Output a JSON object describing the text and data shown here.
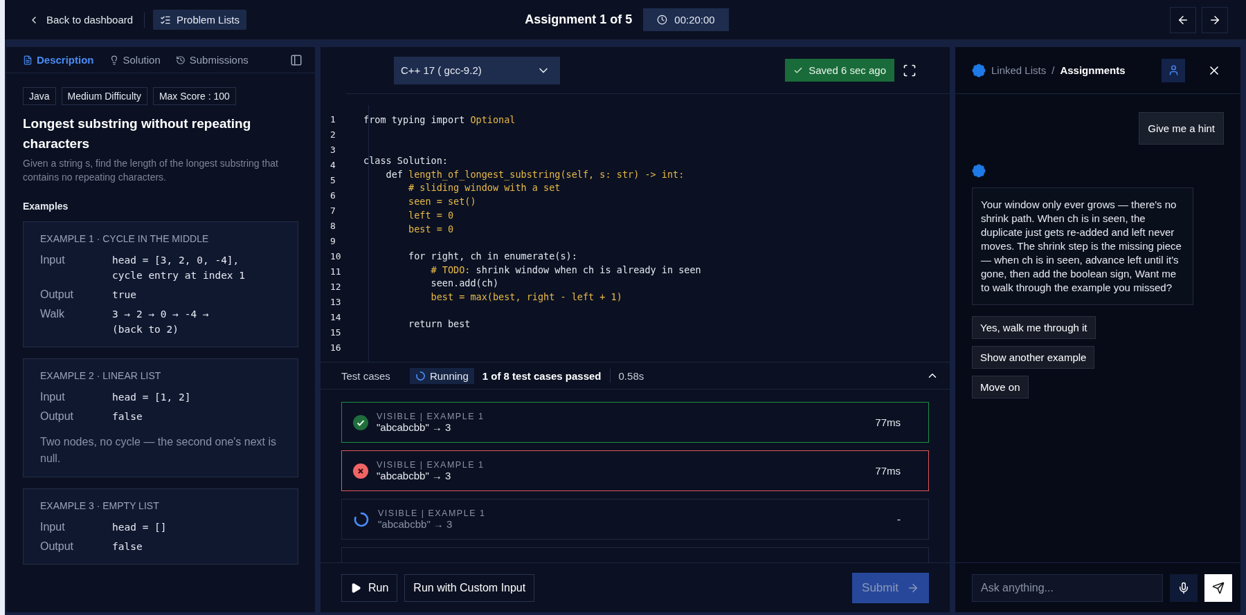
{
  "top_bar": {
    "back_link": "Back to dashboard",
    "problem_lists": "Problem Lists",
    "title": "Assignment 1 of 5",
    "timer": "00:20:00"
  },
  "description_panel": {
    "tabs": [
      {
        "label": "Description",
        "kind": "doc",
        "selected": true
      },
      {
        "label": "Solution",
        "kind": "bulb",
        "selected": false
      },
      {
        "label": "Submissions",
        "kind": "history",
        "selected": false
      }
    ],
    "tags": [
      "Java",
      "Medium Difficulty",
      "Max Score : 100"
    ],
    "title": "Longest substring without repeating characters",
    "description": "Given a string s, find the length of the longest substring that contains no repeating characters.",
    "examples_heading": "Examples",
    "examples": [
      {
        "title": "EXAMPLE 1 · CYCLE IN THE MIDDLE",
        "rows": [
          {
            "label": "Input",
            "lines": [
              "head = [3, 2, 0, -4],",
              "cycle entry at index 1"
            ]
          },
          {
            "label": "Output",
            "lines": [
              "true"
            ]
          },
          {
            "label": "Walk",
            "lines": [
              "3 → 2 → 0 → -4 →",
              "(back to 2)"
            ]
          }
        ]
      },
      {
        "title": "EXAMPLE 2 · LINEAR LIST",
        "rows": [
          {
            "label": "Input",
            "lines": [
              "head = [1, 2]"
            ]
          },
          {
            "label": "Output",
            "lines": [
              "false"
            ]
          }
        ],
        "note": "Two nodes, no cycle — the second one's next is null."
      },
      {
        "title": "EXAMPLE 3 · EMPTY LIST",
        "rows": [
          {
            "label": "Input",
            "lines": [
              "head = []"
            ]
          },
          {
            "label": "Output",
            "lines": [
              "false"
            ]
          }
        ]
      }
    ]
  },
  "editor": {
    "language": "C++ 17 ( gcc-9.2)",
    "saved": "Saved 6 sec ago",
    "line_numbers": [
      "1",
      "2",
      "3",
      "4",
      "5",
      "6",
      "7",
      "8",
      "9",
      "10",
      "11",
      "12",
      "13",
      "14",
      "15",
      "16"
    ],
    "lines": [
      {
        "kind": "code",
        "segments": [
          {
            "text": "from typing import ",
            "kind": "plain"
          },
          {
            "text": "Optional",
            "kind": "accent"
          }
        ]
      },
      {
        "kind": "blank"
      },
      {
        "kind": "blank"
      },
      {
        "segments": [
          {
            "text": "class Solution:",
            "kind": "plain"
          }
        ]
      },
      {
        "segments": [
          {
            "text": "    def ",
            "kind": "plain"
          },
          {
            "text": "length_of_longest_substring(self, s: str) -> int:",
            "kind": "accent"
          }
        ]
      },
      {
        "segments": [
          {
            "text": "        # sliding window with a set",
            "kind": "accent"
          }
        ]
      },
      {
        "segments": [
          {
            "text": "        seen = set()",
            "kind": "accent"
          }
        ]
      },
      {
        "segments": [
          {
            "text": "        left = 0",
            "kind": "accent"
          }
        ]
      },
      {
        "segments": [
          {
            "text": "        best = 0",
            "kind": "accent"
          }
        ]
      },
      {
        "kind": "blank"
      },
      {
        "segments": [
          {
            "text": "        for right, ch in enumerate(s):",
            "kind": "plain"
          }
        ]
      },
      {
        "segments": [
          {
            "text": "            # TODO:",
            "kind": "accent"
          },
          {
            "text": " shrink window when ch is already in seen",
            "kind": "plain"
          }
        ]
      },
      {
        "segments": [
          {
            "text": "            seen.add(ch)",
            "kind": "plain"
          }
        ]
      },
      {
        "segments": [
          {
            "text": "            best = max(best, right - left + 1)",
            "kind": "accent"
          }
        ]
      },
      {
        "kind": "blank"
      },
      {
        "segments": [
          {
            "text": "        return best",
            "kind": "plain"
          }
        ]
      }
    ]
  },
  "test_cases": {
    "heading": "Test cases",
    "status": "Running",
    "summary": "1 of 8 test cases passed",
    "duration": "0.58s",
    "expanded": true,
    "cases": [
      {
        "kind": "passed",
        "label": "VISIBLE | EXAMPLE 1",
        "case": "\"abcabcbb\" → 3",
        "time": "77ms"
      },
      {
        "kind": "failed",
        "label": "VISIBLE | EXAMPLE 1",
        "case": "\"abcabcbb\" → 3",
        "time": "77ms"
      },
      {
        "kind": "running",
        "label": "VISIBLE | EXAMPLE 1",
        "case": "\"abcabcbb\" → 3",
        "time": "-"
      }
    ]
  },
  "actions": {
    "run": "Run",
    "custom": "Run with Custom Input",
    "submit": "Submit",
    "submit_disabled": true
  },
  "assistant": {
    "breadcrumb": "Linked Lists",
    "separator": "/",
    "current": "Assignments",
    "messages": [
      {
        "kind": "user",
        "text": "Give me a hint"
      },
      {
        "kind": "assistant",
        "text": "Your window only ever grows — there's no shrink path. When ch is in seen, the duplicate just gets re-added and left never moves. The shrink step is the missing piece — when ch is in seen, advance left until it's gone, then add the boolean sign, Want me to walk through the example you missed?"
      }
    ],
    "suggestions": [
      "Yes, walk me through it",
      "Show another example",
      "Move on"
    ],
    "input": {
      "placeholder": "Ask anything..."
    }
  }
}
